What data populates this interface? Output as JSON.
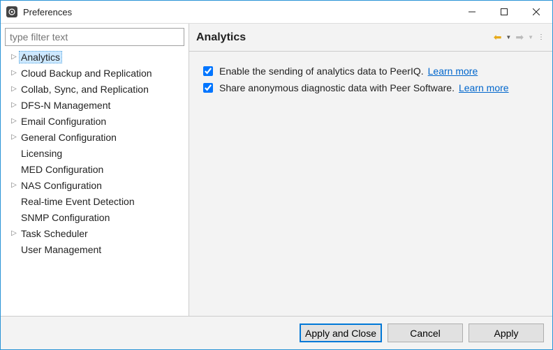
{
  "window": {
    "title": "Preferences"
  },
  "sidebar": {
    "filter_placeholder": "type filter text",
    "items": [
      {
        "label": "Analytics",
        "expandable": true,
        "selected": true
      },
      {
        "label": "Cloud Backup and Replication",
        "expandable": true
      },
      {
        "label": "Collab, Sync, and Replication",
        "expandable": true
      },
      {
        "label": "DFS-N Management",
        "expandable": true
      },
      {
        "label": "Email Configuration",
        "expandable": true
      },
      {
        "label": "General Configuration",
        "expandable": true
      },
      {
        "label": "Licensing",
        "expandable": false
      },
      {
        "label": "MED Configuration",
        "expandable": false
      },
      {
        "label": "NAS Configuration",
        "expandable": true
      },
      {
        "label": "Real-time Event Detection",
        "expandable": false
      },
      {
        "label": "SNMP Configuration",
        "expandable": false
      },
      {
        "label": "Task Scheduler",
        "expandable": true
      },
      {
        "label": "User Management",
        "expandable": false
      }
    ]
  },
  "main": {
    "heading": "Analytics",
    "options": [
      {
        "checked": true,
        "text": "Enable the sending of analytics data to PeerIQ.",
        "link": "Learn more"
      },
      {
        "checked": true,
        "text": "Share anonymous diagnostic data with Peer Software.",
        "link": "Learn more"
      }
    ]
  },
  "buttons": {
    "apply_close": "Apply and Close",
    "cancel": "Cancel",
    "apply": "Apply"
  }
}
